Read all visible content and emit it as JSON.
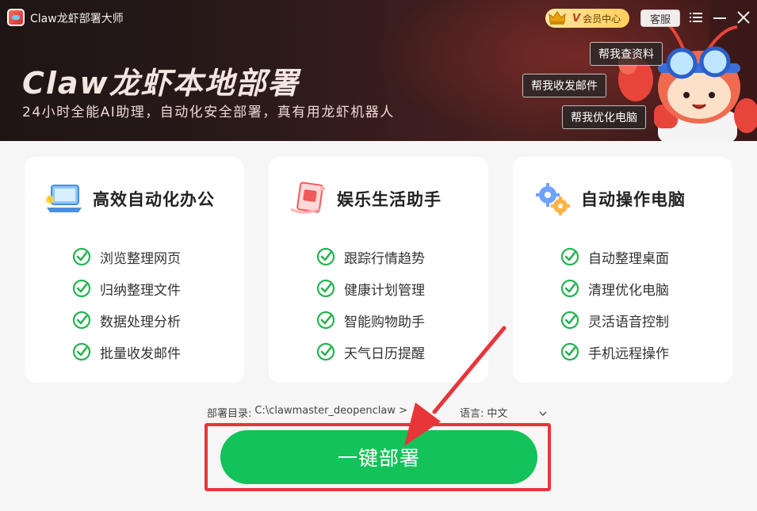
{
  "titlebar": {
    "app_title": "Claw龙虾部署大师",
    "vip_badge": "V",
    "vip_label": "会员中心",
    "service_label": "客服"
  },
  "banner": {
    "title": "Claw龙虾本地部署",
    "subtitle": "24小时全能AI助理，自动化安全部署，真有用龙虾机器人",
    "help_buttons": [
      "帮我查资料",
      "帮我收发邮件",
      "帮我优化电脑"
    ]
  },
  "cards": [
    {
      "title": "高效自动化办公",
      "icon": "office-icon",
      "items": [
        "浏览整理网页",
        "归纳整理文件",
        "数据处理分析",
        "批量收发邮件"
      ]
    },
    {
      "title": "娱乐生活助手",
      "icon": "life-assistant-icon",
      "items": [
        "跟踪行情趋势",
        "健康计划管理",
        "智能购物助手",
        "天气日历提醒"
      ]
    },
    {
      "title": "自动操作电脑",
      "icon": "gears-icon",
      "items": [
        "自动整理桌面",
        "清理优化电脑",
        "灵活语音控制",
        "手机远程操作"
      ]
    }
  ],
  "footer": {
    "dir_label": "部署目录:",
    "dir_path": "C:\\clawmaster_deopenclaw >",
    "lang_label": "语言:",
    "lang_value": "中文",
    "deploy_label": "一键部署"
  },
  "colors": {
    "accent_green": "#14c25a",
    "highlight_red": "#e8353a",
    "check_green": "#27b350"
  }
}
